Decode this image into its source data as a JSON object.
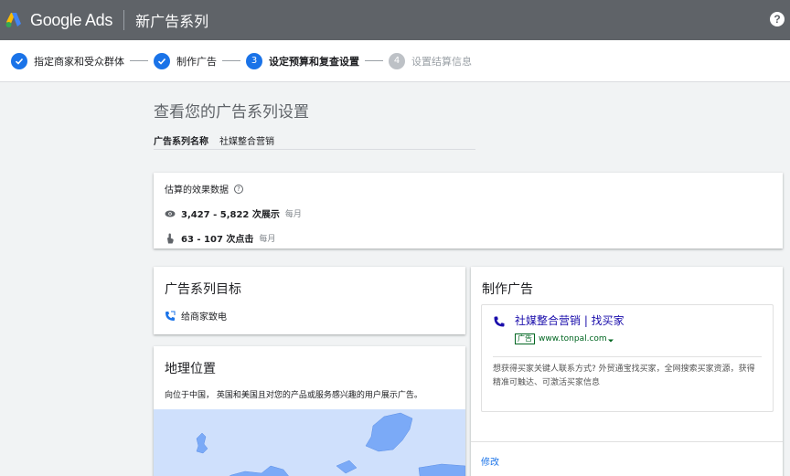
{
  "header": {
    "brand": "Google Ads",
    "campaign_title": "新广告系列",
    "help_icon": "?"
  },
  "stepper": {
    "steps": [
      {
        "label": "指定商家和受众群体",
        "status": "done"
      },
      {
        "label": "制作广告",
        "status": "done"
      },
      {
        "label": "设定预算和复查设置",
        "status": "active",
        "number": "3"
      },
      {
        "label": "设置结算信息",
        "status": "todo",
        "number": "4"
      }
    ]
  },
  "main": {
    "heading": "查看您的广告系列设置",
    "campaign_name_label": "广告系列名称",
    "campaign_name_value": "社媒整合营销"
  },
  "estimates": {
    "title": "估算的效果数据",
    "impressions": "3,427 - 5,822 次展示",
    "impressions_period": "每月",
    "clicks": "63 - 107 次点击",
    "clicks_period": "每月"
  },
  "goal": {
    "title": "广告系列目标",
    "value": "给商家致电"
  },
  "geo": {
    "title": "地理位置",
    "description": "向位于中国， 英国和美国且对您的产品或服务感兴趣的用户展示广告。"
  },
  "ad": {
    "title": "制作广告",
    "headline": "社媒整合营销 | 找买家",
    "badge": "广告",
    "url": "www.tonpal.com",
    "description": "想获得买家关键人联系方式? 外贸通宝找买家，全网搜索买家资源，获得精准可触达、可激活买家信息",
    "edit_label": "修改"
  },
  "colors": {
    "topbar": "#5f6368",
    "accent": "#1a73e8",
    "ad_headline": "#1a0dab",
    "ad_url": "#006621",
    "map_water": "#cfe0fc",
    "map_land": "#7baaf7"
  }
}
